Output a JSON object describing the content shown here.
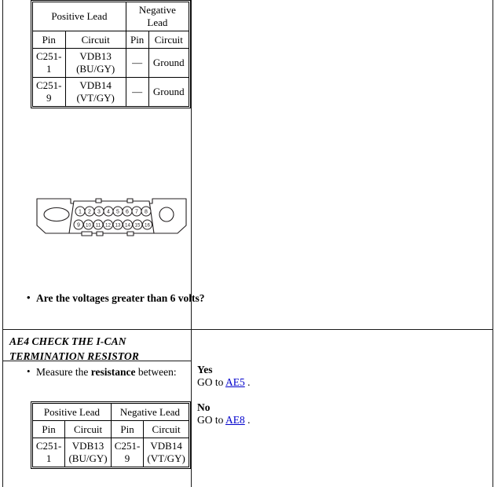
{
  "document": {
    "type": "vehicle-diagnostic-pinpoint-test",
    "colors": {
      "link": "#0000cc",
      "rule": "#1a1a1a",
      "text": "#000000",
      "background": "#ffffff"
    }
  },
  "step_ae3": {
    "voltage_table": {
      "group_headers": [
        "Positive Lead",
        "Negative Lead"
      ],
      "column_headers": [
        "Pin",
        "Circuit",
        "Pin",
        "Circuit"
      ],
      "rows": [
        [
          "C251-1",
          "VDB13 (BU/GY)",
          "—",
          "Ground"
        ],
        [
          "C251-9",
          "VDB14 (VT/GY)",
          "—",
          "Ground"
        ]
      ],
      "rows_split": [
        {
          "pin_pos_a": "C251-",
          "pin_pos_b": "1",
          "circuit_pos_a": "VDB13",
          "circuit_pos_b": "(BU/GY)",
          "pin_neg": "—",
          "circuit_neg": "Ground"
        },
        {
          "pin_pos_a": "C251-",
          "pin_pos_b": "9",
          "circuit_pos_a": "VDB14",
          "circuit_pos_b": "(VT/GY)",
          "pin_neg": "—",
          "circuit_neg": "Ground"
        }
      ]
    },
    "connector": {
      "name": "data-link-connector-c251",
      "pin_count": 16,
      "top_row_pins": [
        "1",
        "2",
        "3",
        "4",
        "5",
        "6",
        "7",
        "8"
      ],
      "bottom_row_pins": [
        "9",
        "10",
        "11",
        "12",
        "13",
        "14",
        "15",
        "16"
      ]
    },
    "question": "Are the voltages greater than 6 volts?"
  },
  "step_ae4": {
    "title": "AE4 CHECK THE I-CAN TERMINATION RESISTOR",
    "title_lines": [
      "AE4 CHECK THE I-CAN",
      "TERMINATION RESISTOR"
    ],
    "instruction_prefix": "Measure the ",
    "instruction_bold": "resistance",
    "instruction_suffix": " between:",
    "resistance_table": {
      "group_headers": [
        "Positive Lead",
        "Negative Lead"
      ],
      "column_headers": [
        "Pin",
        "Circuit",
        "Pin",
        "Circuit"
      ],
      "rows": [
        [
          "C251-1",
          "VDB13 (BU/GY)",
          "C251-9",
          "VDB14 (VT/GY)"
        ]
      ],
      "rows_split": [
        {
          "pin_pos_a": "C251-",
          "pin_pos_b": "1",
          "circuit_pos_a": "VDB13",
          "circuit_pos_b": "(BU/GY)",
          "pin_neg_a": "C251-",
          "pin_neg_b": "9",
          "circuit_neg_a": "VDB14",
          "circuit_neg_b": "(VT/GY)"
        }
      ]
    },
    "answers": [
      {
        "label": "Yes",
        "action_prefix": "GO to ",
        "link": "AE5",
        "action_suffix": " ."
      },
      {
        "label": "No",
        "action_prefix": "GO to ",
        "link": "AE8",
        "action_suffix": " ."
      }
    ]
  }
}
